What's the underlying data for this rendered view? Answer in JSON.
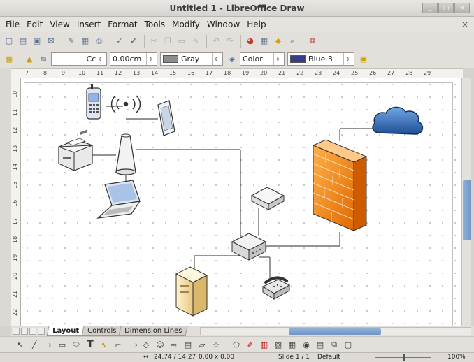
{
  "window": {
    "title": "Untitled 1 - LibreOffice Draw"
  },
  "menu": [
    "File",
    "Edit",
    "View",
    "Insert",
    "Format",
    "Tools",
    "Modify",
    "Window",
    "Help"
  ],
  "line_toolbar": {
    "line_style": "Cc",
    "line_width": "0.00cm",
    "line_color": "Gray",
    "area_style": "Color",
    "area_color": "Blue 3",
    "colors": {
      "gray": "#8c8c8c",
      "blue3": "#3a3a8c"
    }
  },
  "rulers": {
    "horizontal": [
      "7",
      "8",
      "9",
      "10",
      "11",
      "12",
      "13",
      "14",
      "15",
      "16",
      "17",
      "18",
      "19",
      "20",
      "21",
      "22",
      "23",
      "24",
      "25",
      "26",
      "27",
      "28",
      "29"
    ],
    "vertical": [
      "10",
      "11",
      "12",
      "13",
      "14",
      "15",
      "16",
      "17",
      "18",
      "19",
      "20",
      "21",
      "22"
    ]
  },
  "tabs": [
    "Layout",
    "Controls",
    "Dimension Lines"
  ],
  "status": {
    "position": "24.74 / 14.27",
    "size": "0.00 x 0.00",
    "slide": "Slide 1 / 1",
    "layout": "Default",
    "zoom": "100%"
  },
  "icons": {
    "devices": [
      "phone-icon",
      "wireless-access-point-icon",
      "tablet-icon",
      "printer-icon",
      "laptop-icon",
      "cloud-icon",
      "firewall-icon",
      "hub-icon",
      "router-icon",
      "server-icon",
      "telephone-icon"
    ]
  }
}
